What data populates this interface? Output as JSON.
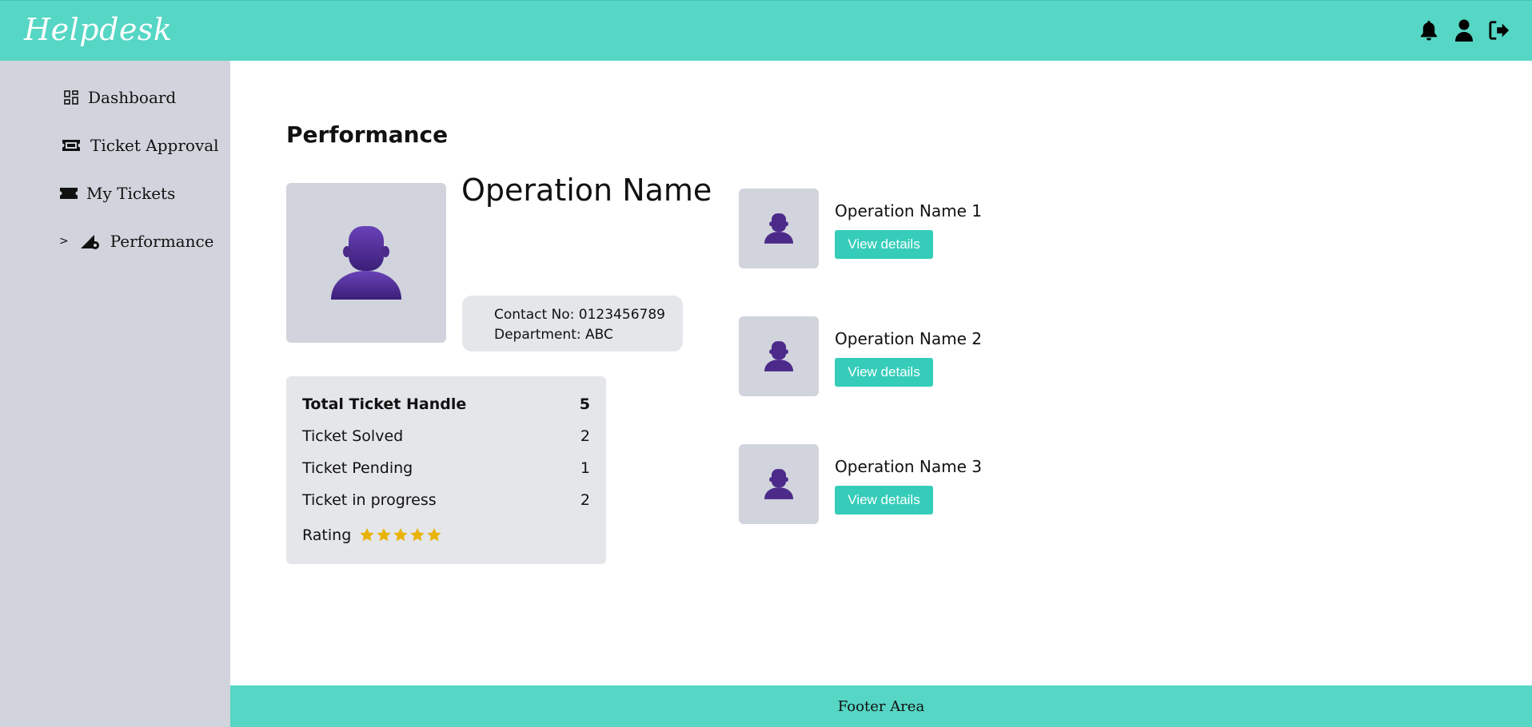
{
  "header": {
    "brand": "Helpdesk",
    "icons": [
      "bell-icon",
      "user-icon",
      "logout-icon"
    ]
  },
  "sidebar": {
    "items": [
      {
        "label": "Dashboard",
        "icon": "dashboard-icon"
      },
      {
        "label": "Ticket Approval",
        "icon": "ticket-icon"
      },
      {
        "label": "My Tickets",
        "icon": "ticket-filled-icon"
      },
      {
        "label": "Performance",
        "icon": "performance-icon",
        "active_marker": ">"
      }
    ]
  },
  "main": {
    "title": "Performance",
    "profile": {
      "name": "Operation Name",
      "contact": "Contact No: 0123456789",
      "department": "Department: ABC"
    },
    "stats": [
      {
        "label": "Total Ticket Handle",
        "value": "5"
      },
      {
        "label": "Ticket Solved",
        "value": "2"
      },
      {
        "label": "Ticket Pending",
        "value": "1"
      },
      {
        "label": "Ticket in progress",
        "value": "2"
      }
    ],
    "rating": {
      "label": "Rating",
      "stars": 5,
      "max": 5
    },
    "operations": [
      {
        "name": "Operation Name 1",
        "button": "View details"
      },
      {
        "name": "Operation Name 2",
        "button": "View details"
      },
      {
        "name": "Operation Name 3",
        "button": "View details"
      }
    ]
  },
  "footer": {
    "text": "Footer Area"
  },
  "colors": {
    "header_bg": "#56d6c4",
    "sidebar_bg": "#d1d4dc",
    "card_bg": "#e4e6ea",
    "button_bg": "#35cdb9",
    "avatar_purple": "#4b2a8a",
    "star_gold": "#eab308"
  }
}
